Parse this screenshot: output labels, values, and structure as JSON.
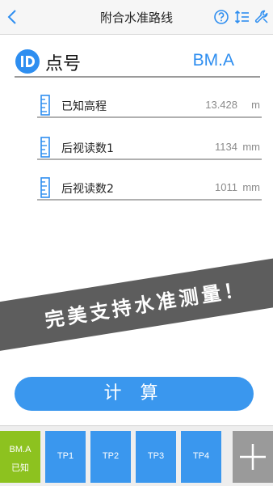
{
  "header": {
    "title": "附合水准路线"
  },
  "point": {
    "label": "点号",
    "value": "BM.A"
  },
  "fields": [
    {
      "label": "已知高程",
      "value": "13.428",
      "unit": "m"
    },
    {
      "label": "后视读数1",
      "value": "1134",
      "unit": "mm"
    },
    {
      "label": "后视读数2",
      "value": "1011",
      "unit": "mm"
    }
  ],
  "banner": {
    "text": "完美支持水准测量！"
  },
  "calculate_label": "计 算",
  "stations": {
    "active": {
      "line1": "BM.A",
      "line2": "已知"
    },
    "tabs": [
      "TP1",
      "TP2",
      "TP3",
      "TP4"
    ]
  },
  "colors": {
    "accent": "#3a97ee",
    "active_station": "#8dc21f",
    "banner": "#5d5d5d"
  },
  "icons": [
    "back-icon",
    "help-icon",
    "sort-icon",
    "wrench-icon",
    "id-icon",
    "ruler-icon",
    "plus-icon"
  ]
}
